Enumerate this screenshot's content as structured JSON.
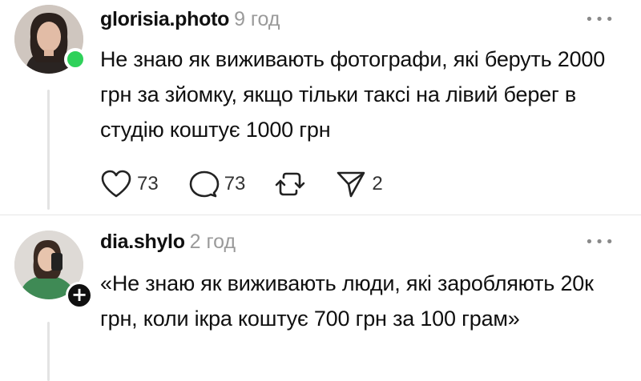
{
  "posts": [
    {
      "username": "glorisia.photo",
      "time": "9 год",
      "more_icon": "ellipsis-icon",
      "text": "Не знаю як виживають фотографи, які беруть 2000 грн за зйомку, якщо тільки таксі на лівий берег в студію коштує 1000 грн",
      "online": true,
      "actions": {
        "like_count": "73",
        "comment_count": "73",
        "repost_count": "",
        "share_count": "2"
      }
    },
    {
      "username": "dia.shylo",
      "time": "2 год",
      "more_icon": "ellipsis-icon",
      "text": "«Не знаю як виживають люди, які заробляють 20к грн, коли ікра коштує 700 грн за 100 грам»",
      "follow_badge": "+"
    }
  ],
  "colors": {
    "online": "#2fd15a",
    "muted": "#9a9a9a",
    "text": "#101010"
  }
}
